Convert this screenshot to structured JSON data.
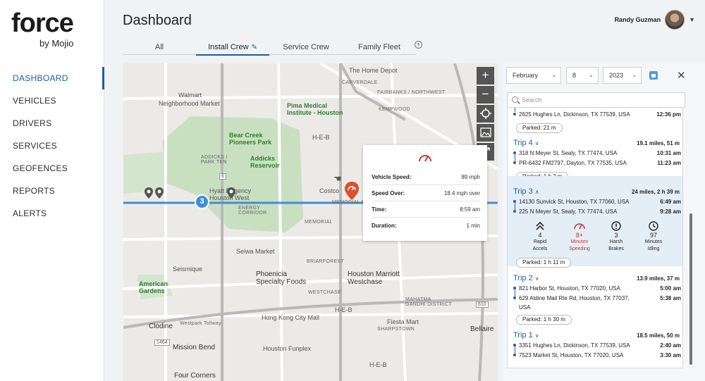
{
  "brand": {
    "name": "force",
    "sub": "by Mojio"
  },
  "nav": [
    {
      "label": "DASHBOARD",
      "active": true
    },
    {
      "label": "VEHICLES"
    },
    {
      "label": "DRIVERS"
    },
    {
      "label": "SERVICES"
    },
    {
      "label": "GEOFENCES"
    },
    {
      "label": "REPORTS"
    },
    {
      "label": "ALERTS"
    }
  ],
  "header": {
    "title": "Dashboard",
    "user_name": "Randy Guzman"
  },
  "tabs": [
    "All",
    "Install Crew",
    "Service Crew",
    "Family Fleet"
  ],
  "map": {
    "labels": {
      "home_depot": "The Home Depot",
      "walmart": "Walmart",
      "neighborhood_market": "Neighborhood Market",
      "carverdale": "CARVERDALE",
      "fairbanks": "FAIRBANKS / NORTHWEST",
      "pima": "Pima Medical\nInstitute - Houston",
      "kempwood": "KEMPWOOD",
      "bear_creek": "Bear Creek\nPioneers Park",
      "addicks_park": "ADDICKS /\nPARK TEN",
      "addicks_reservoir": "Addicks\nReservoir",
      "heb1": "H-E-B",
      "costco": "Costco",
      "hyatt": "Hyatt Regency\nHouston West",
      "energy": "ENERGY\nCORRIDOR",
      "memorial": "MEMORIAL",
      "seiwa": "Seiwa Market",
      "briarforest": "BRIARFOREST",
      "seismique": "Seismique",
      "phoenicia": "Phoenicia\nSpecialty Foods",
      "marriott": "Houston Marriott\nWestchase",
      "american_gardens": "American\nGardens",
      "westchase": "WESTCHASE",
      "mahatma": "MAHATMA\nGANDHI DISTRICT",
      "clodine": "Clodine",
      "westpark": "Westpark Tollway",
      "hongkong": "Hong Kong City Mall",
      "sharpstown": "SHARPSTOWN",
      "fiesta": "Fiesta Mart",
      "bellaire": "Bellaire",
      "mission_bend": "Mission Bend",
      "funplex": "Houston Funplex",
      "four_corners": "Four Corners",
      "heb2": "H-E-B",
      "heb3": "H-E-B",
      "memorial_dr": "MEMORIAL DR",
      "shield_6": "6",
      "shield_1464": "1464",
      "shield_610": "610"
    },
    "cluster_count": "3",
    "controls": [
      "+",
      "−"
    ]
  },
  "popup": {
    "rows": [
      {
        "label": "Vehicle Speed:",
        "value": "89 mph"
      },
      {
        "label": "Speed Over:",
        "value": "18.4 mph over"
      },
      {
        "label": "Time:",
        "value": "8:59 am"
      },
      {
        "label": "Duration:",
        "value": "1 min"
      }
    ]
  },
  "panel": {
    "month": "February",
    "day": "8",
    "year": "2023",
    "search_placeholder": "Search",
    "top_addr": {
      "address": "2625 Hughes Ln, Dickinson, TX 77539, USA",
      "time": "12:36 pm"
    },
    "top_parked": "Parked: 21 m",
    "trip4": {
      "name": "Trip 4",
      "meta": "19.1 miles, 51 m",
      "from": "318 N Meyer St, Sealy, TX 77474, USA",
      "from_time": "10:31 am",
      "to": "PR-6432 FM2797, Dayton, TX 77535, USA",
      "to_time": "11:23 am",
      "parked": "Parked: 1 h 2 m"
    },
    "trip3": {
      "name": "Trip 3",
      "meta": "24 miles, 2 h 39 m",
      "from": "14130 Sunvick St, Houston, TX 77060, USA",
      "from_time": "6:49 am",
      "to": "225 N Meyer St, Sealy, TX 77474, USA",
      "to_time": "9:28 am",
      "stats": [
        {
          "value": "4",
          "label1": "Rapid",
          "label2": "Accels"
        },
        {
          "value": "8+",
          "label1": "Minutes",
          "label2": "Speeding"
        },
        {
          "value": "3",
          "label1": "Harsh",
          "label2": "Brakes"
        },
        {
          "value": "97",
          "label1": "Minutes",
          "label2": "Idling"
        }
      ],
      "parked": "Parked: 1 h 11 m"
    },
    "trip2": {
      "name": "Trip 2",
      "meta": "13.9 miles, 37 m",
      "from": "821 Harbor St, Houston, TX 77020, USA",
      "from_time": "5:00 am",
      "to": "629 Aldine Mail Rte Rd, Houston, TX 77037,",
      "to_line2": "USA",
      "to_time": "5:38 am",
      "parked": "Parked: 1 h 30 m"
    },
    "trip1": {
      "name": "Trip 1",
      "meta": "18.5 miles, 50 m",
      "from": "3351 Hughes Ln, Dickinson, TX 77539, USA",
      "from_time": "2:40 am",
      "to": "7523 Market St, Houston, TX 77020, USA",
      "to_time": "3:30 am"
    }
  },
  "colors": {
    "accent": "#1a5ea8",
    "route": "#3a8fd9",
    "speeding": "#c0392b",
    "selected_trip": "#e4eef7"
  }
}
